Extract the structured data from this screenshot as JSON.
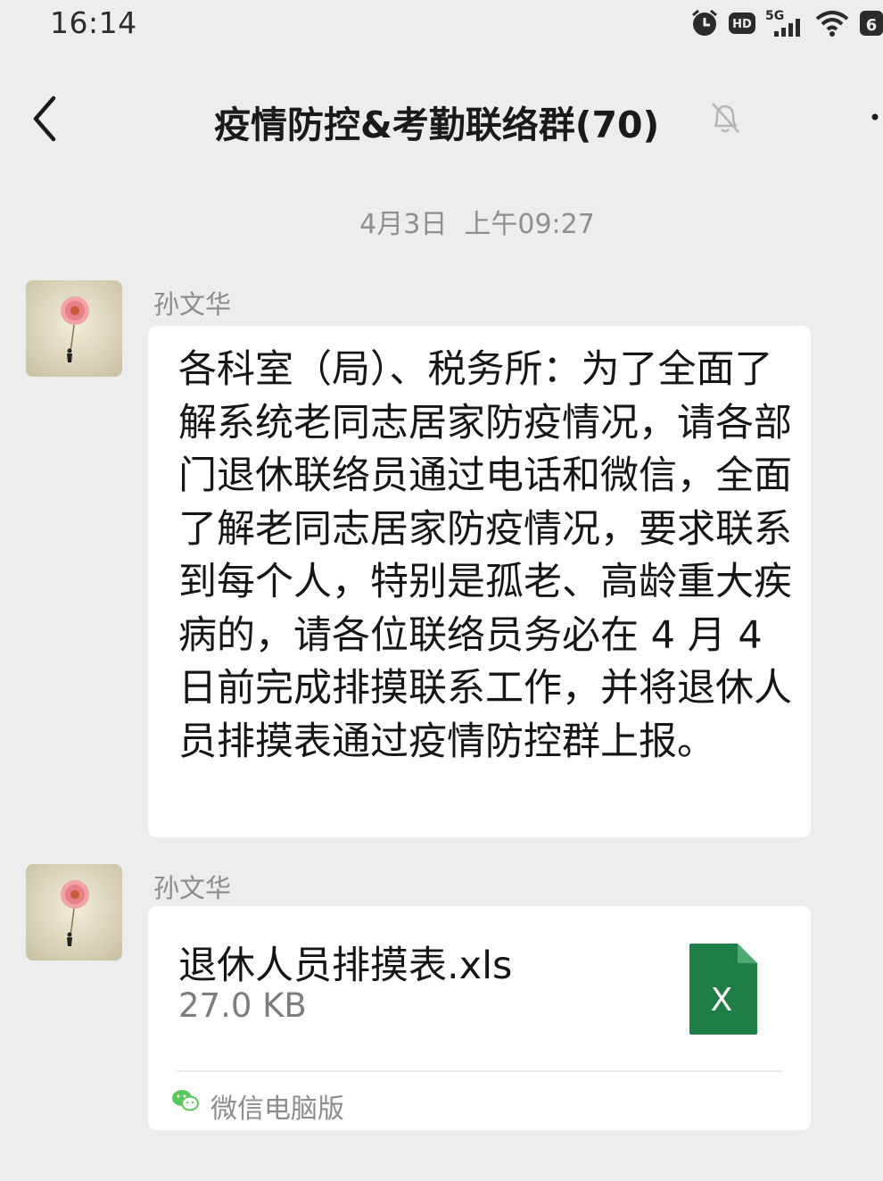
{
  "status_bar": {
    "time": "16:14",
    "network_label": "5G",
    "hd_label": "HD",
    "battery_label": "6"
  },
  "header": {
    "title": "疫情防控&考勤联络群(70)"
  },
  "chat": {
    "timestamp": "4月3日  上午09:27",
    "messages": [
      {
        "sender": "孙文华",
        "text": "各科室（局）、税务所：为了全面了解系统老同志居家防疫情况，请各部门退休联络员通过电话和微信，全面了解老同志居家防疫情况，要求联系到每个人，特别是孤老、高龄重大疾病的，请各位联络员务必在 4 月 4 日前完成排摸联系工作，并将退休人员排摸表通过疫情防控群上报。"
      },
      {
        "sender": "孙文华",
        "file_name": "退休人员排摸表.xls",
        "file_size": "27.0  KB",
        "file_icon_label": "X",
        "source": "微信电脑版"
      }
    ]
  },
  "colors": {
    "background": "#ededed",
    "bubble": "#ffffff",
    "excel_green": "#1e7e45",
    "wechat_green": "#5ac85a"
  }
}
